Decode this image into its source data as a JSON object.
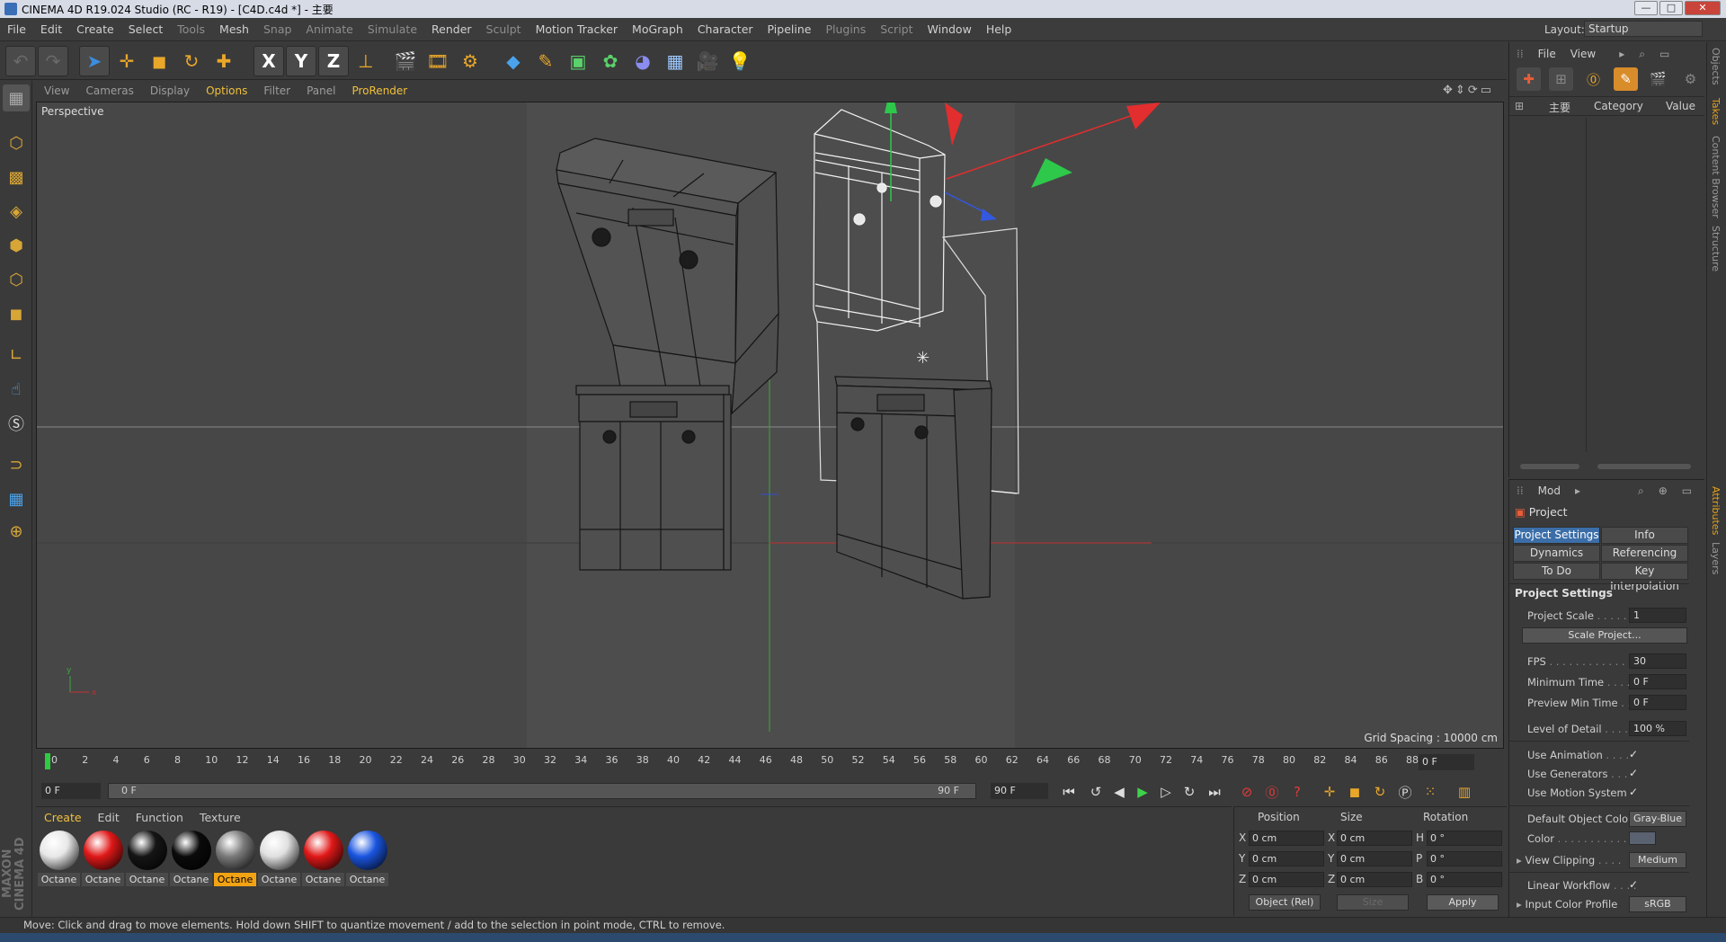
{
  "window": {
    "title": "CINEMA 4D R19.024 Studio (RC - R19) - [C4D.c4d *] - 主要",
    "minimize_glyph": "—",
    "maximize_glyph": "□",
    "close_glyph": "✕"
  },
  "menubar": {
    "items": [
      "File",
      "Edit",
      "Create",
      "Select",
      "Tools",
      "Mesh",
      "Snap",
      "Animate",
      "Simulate",
      "Render",
      "Sculpt",
      "Motion Tracker",
      "MoGraph",
      "Character",
      "Pipeline",
      "Plugins",
      "Script",
      "Window",
      "Help"
    ],
    "layout_label": "Layout:",
    "layout_value": "Startup"
  },
  "toolbar": {
    "axis_x": "X",
    "axis_y": "Y",
    "axis_z": "Z"
  },
  "viewport_menu": {
    "items": [
      "View",
      "Cameras",
      "Display",
      "Options",
      "Filter",
      "Panel",
      "ProRender"
    ],
    "highlighted": [
      "Options",
      "ProRender"
    ]
  },
  "viewport": {
    "label": "Perspective",
    "grid_spacing": "Grid Spacing : 10000 cm",
    "axis_x": "x",
    "axis_y": "y"
  },
  "timeline": {
    "ticks": [
      "0",
      "2",
      "4",
      "6",
      "8",
      "10",
      "12",
      "14",
      "16",
      "18",
      "20",
      "22",
      "24",
      "26",
      "28",
      "30",
      "32",
      "34",
      "36",
      "38",
      "40",
      "42",
      "44",
      "46",
      "48",
      "50",
      "52",
      "54",
      "56",
      "58",
      "60",
      "62",
      "64",
      "66",
      "68",
      "70",
      "72",
      "74",
      "76",
      "78",
      "80",
      "82",
      "84",
      "86",
      "88",
      "90"
    ],
    "current_frame": "0 F",
    "start_frame": "0 F",
    "range_start": "0 F",
    "range_end": "90 F",
    "end_frame": "90 F"
  },
  "material_panel": {
    "tabs": [
      "Create",
      "Edit",
      "Function",
      "Texture"
    ],
    "materials": [
      {
        "name": "Octane",
        "color": "#e8e8e8",
        "selected": false
      },
      {
        "name": "Octane",
        "color": "#e01818",
        "selected": false
      },
      {
        "name": "Octane",
        "color": "#151515",
        "selected": false
      },
      {
        "name": "Octane",
        "color": "#0a0a0a",
        "selected": false
      },
      {
        "name": "Octane",
        "color": "#7a7a7a",
        "selected": true
      },
      {
        "name": "Octane",
        "color": "#e0e0e0",
        "selected": false
      },
      {
        "name": "Octane",
        "color": "#e01818",
        "selected": false
      },
      {
        "name": "Octane",
        "color": "#1a55e0",
        "selected": false
      }
    ]
  },
  "coordinates": {
    "headers": [
      "Position",
      "Size",
      "Rotation"
    ],
    "position": {
      "x": "0 cm",
      "y": "0 cm",
      "z": "0 cm"
    },
    "size": {
      "x": "0 cm",
      "y": "0 cm",
      "z": "0 cm"
    },
    "rotation": {
      "h": "0 °",
      "p": "0 °",
      "b": "0 °"
    },
    "labels": {
      "x": "X",
      "y": "Y",
      "z": "Z",
      "h": "H",
      "p": "P",
      "b": "B"
    },
    "mode": "Object (Rel)",
    "size_mode": "Size",
    "apply": "Apply"
  },
  "object_manager": {
    "menu": [
      "File",
      "View"
    ],
    "column_name": "主要",
    "column_category": "Category",
    "column_value": "Value"
  },
  "attribute_manager": {
    "menu": [
      "Mod"
    ],
    "object": "Project",
    "tabs": [
      "Project Settings",
      "Info",
      "Dynamics",
      "Referencing",
      "To Do",
      "Key Interpolation"
    ],
    "section": "Project Settings",
    "rows": {
      "project_scale": {
        "label": "Project Scale",
        "value": "1"
      },
      "scale_project": "Scale Project...",
      "fps": {
        "label": "FPS",
        "value": "30"
      },
      "min_time": {
        "label": "Minimum Time",
        "value": "0 F"
      },
      "preview_min": {
        "label": "Preview Min Time",
        "value": "0 F"
      },
      "lod": {
        "label": "Level of Detail",
        "value": "100 %"
      },
      "use_animation": {
        "label": "Use Animation",
        "value": "✓"
      },
      "use_generators": {
        "label": "Use Generators",
        "value": "✓"
      },
      "use_motion": {
        "label": "Use Motion System",
        "value": "✓"
      },
      "default_color": {
        "label": "Default Object Color",
        "value": "Gray-Blue"
      },
      "color": {
        "label": "Color"
      },
      "view_clipping": {
        "label": "View Clipping",
        "value": "Medium"
      },
      "linear_workflow": {
        "label": "Linear Workflow",
        "value": "✓"
      },
      "input_profile": {
        "label": "Input Color Profile",
        "value": "sRGB"
      }
    }
  },
  "side_tabs": [
    "Objects",
    "Takes",
    "Content Browser",
    "Structure",
    "Attributes",
    "Layers"
  ],
  "maxon_logo": "MAXON CINEMA 4D",
  "status": "Move: Click and drag to move elements. Hold down SHIFT to quantize movement / add to the selection in point mode, CTRL to remove."
}
